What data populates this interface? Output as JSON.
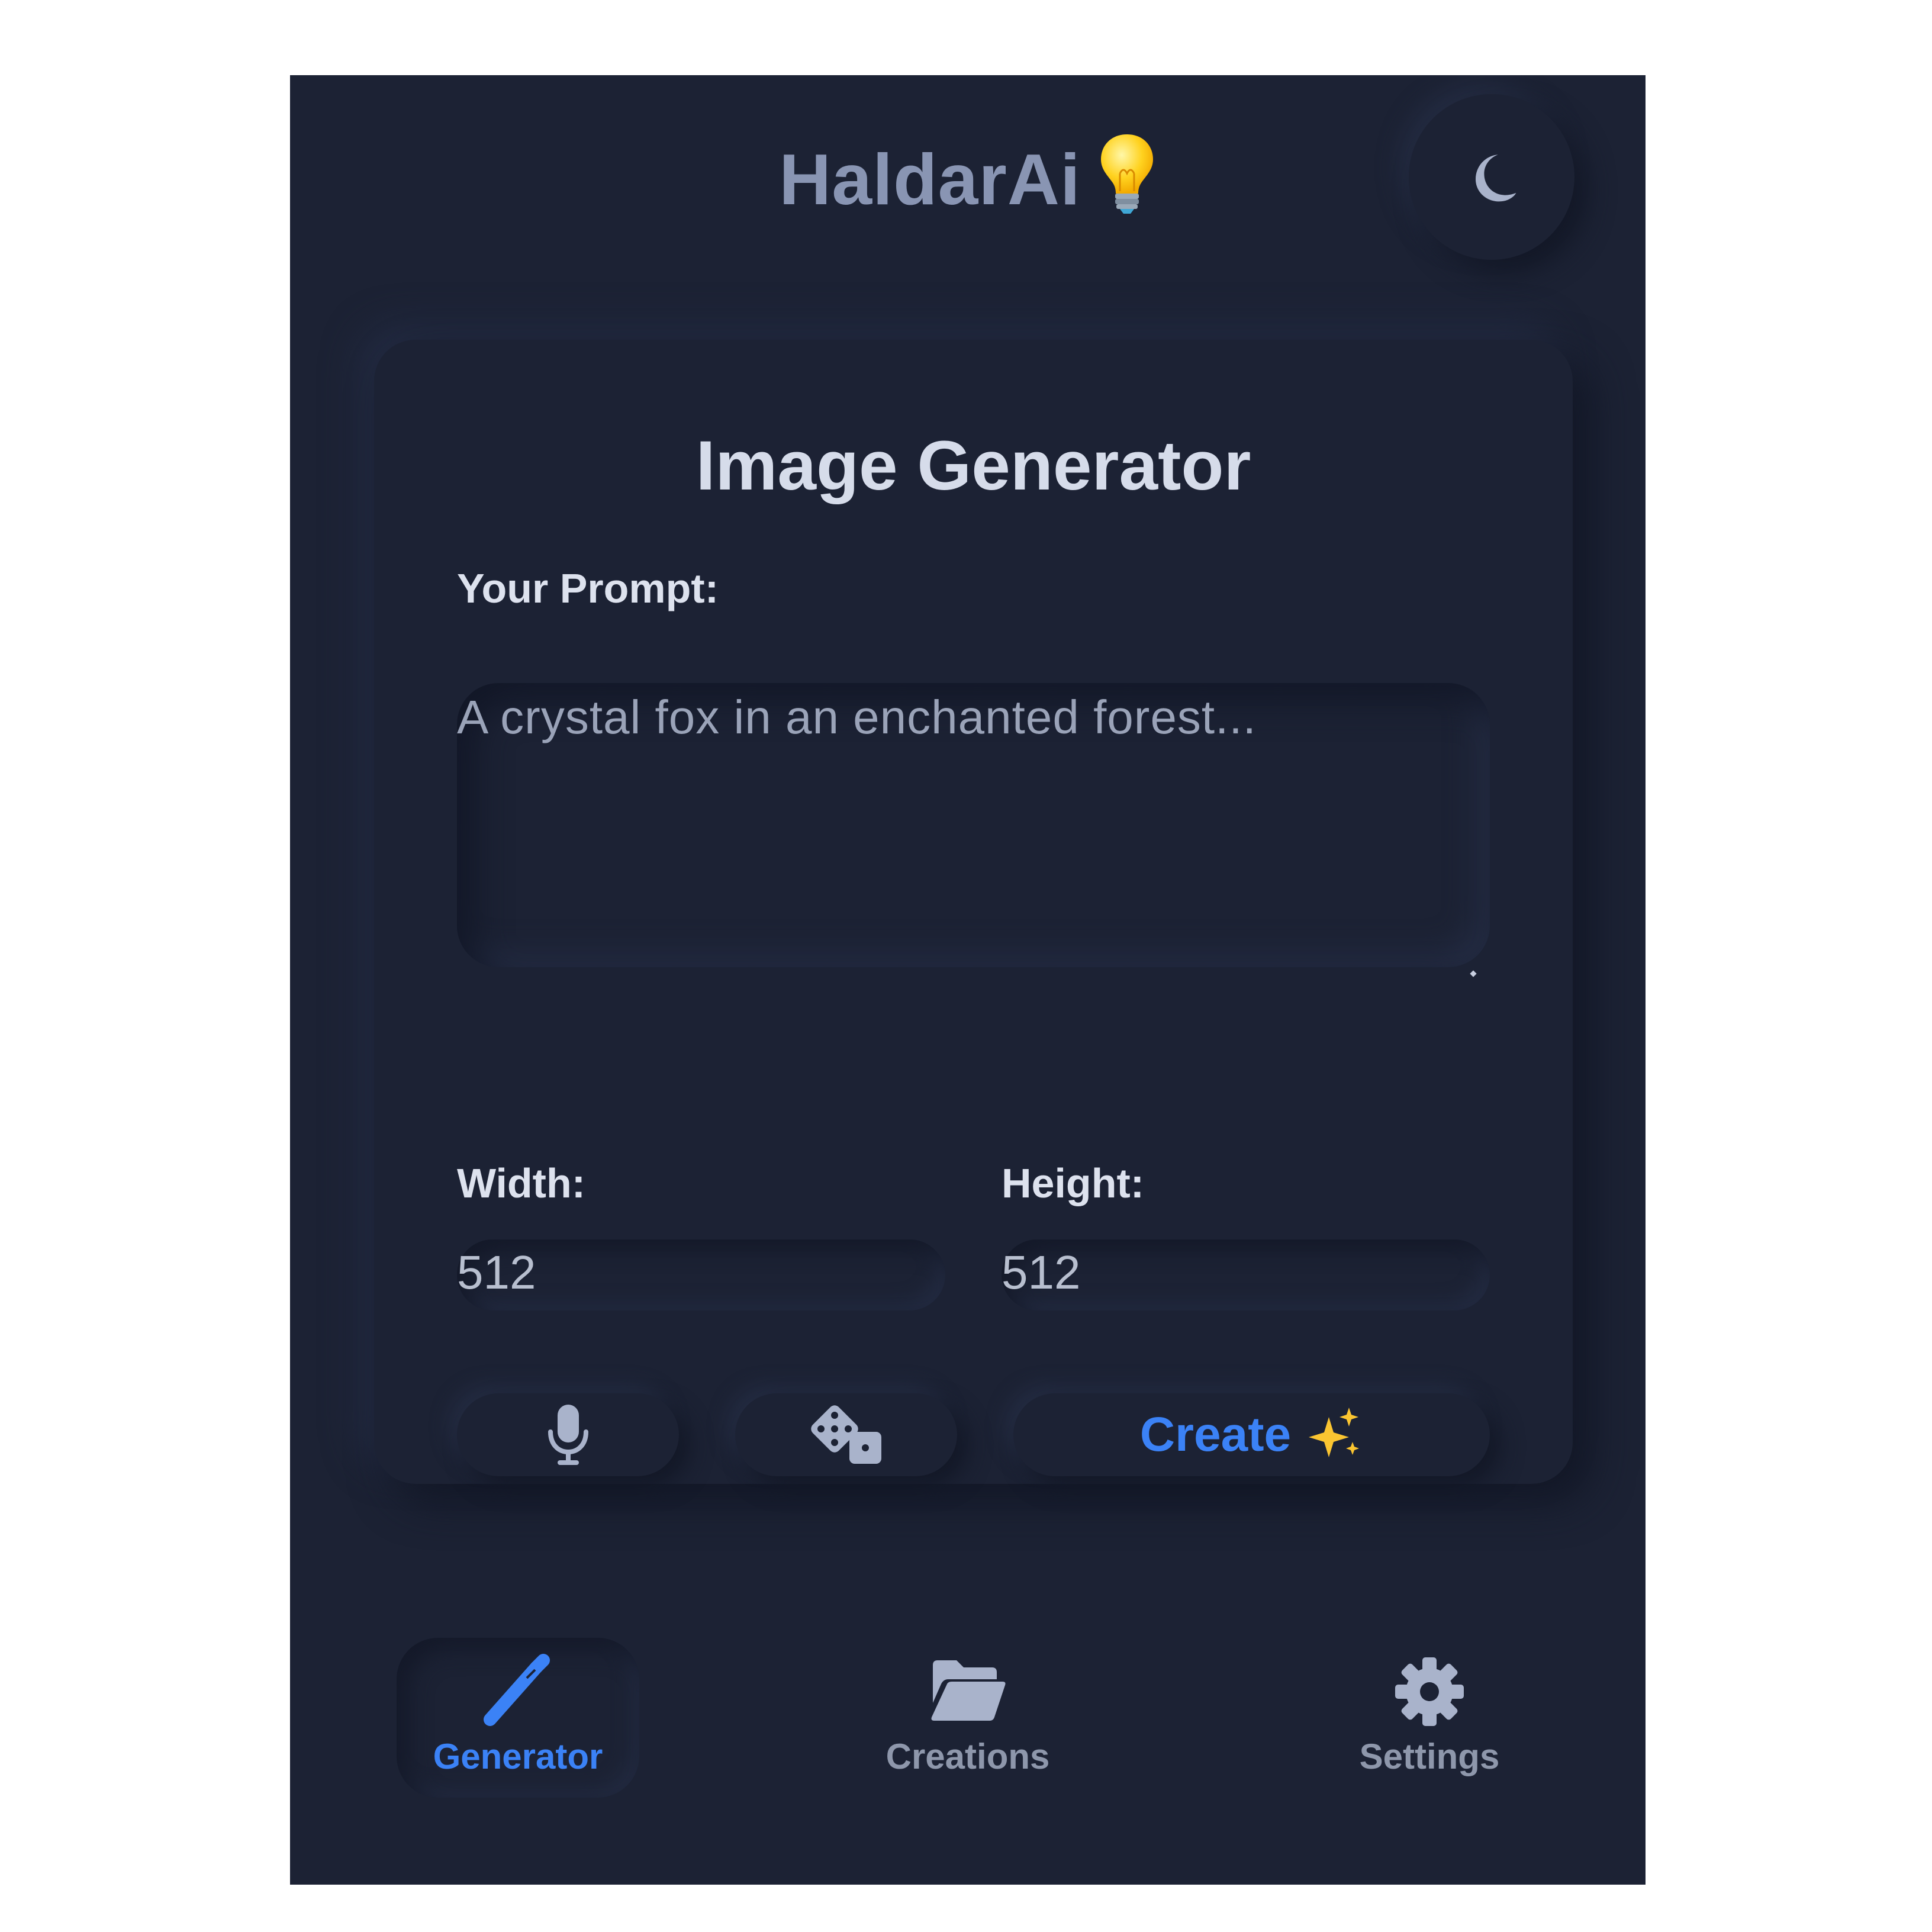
{
  "colors": {
    "background": "#1c2234",
    "accent": "#3b82f6",
    "brand_text": "#8995b3",
    "muted_text": "#8e97ab"
  },
  "header": {
    "brand": "HaldarAi",
    "brand_icon": "lightbulb-icon",
    "theme_toggle_icon": "moon-icon"
  },
  "generator": {
    "title": "Image Generator",
    "prompt_label": "Your Prompt:",
    "prompt_placeholder": "A crystal fox in an enchanted forest...",
    "width_label": "Width:",
    "width_value": "512",
    "height_label": "Height:",
    "height_value": "512",
    "voice_button_icon": "microphone-icon",
    "random_button_icon": "dice-icon",
    "create_label": "Create",
    "create_icon": "sparkles-icon"
  },
  "nav": {
    "items": [
      {
        "label": "Generator",
        "icon": "magic-wand-icon",
        "active": true
      },
      {
        "label": "Creations",
        "icon": "folder-open-icon",
        "active": false
      },
      {
        "label": "Settings",
        "icon": "gear-icon",
        "active": false
      }
    ]
  }
}
